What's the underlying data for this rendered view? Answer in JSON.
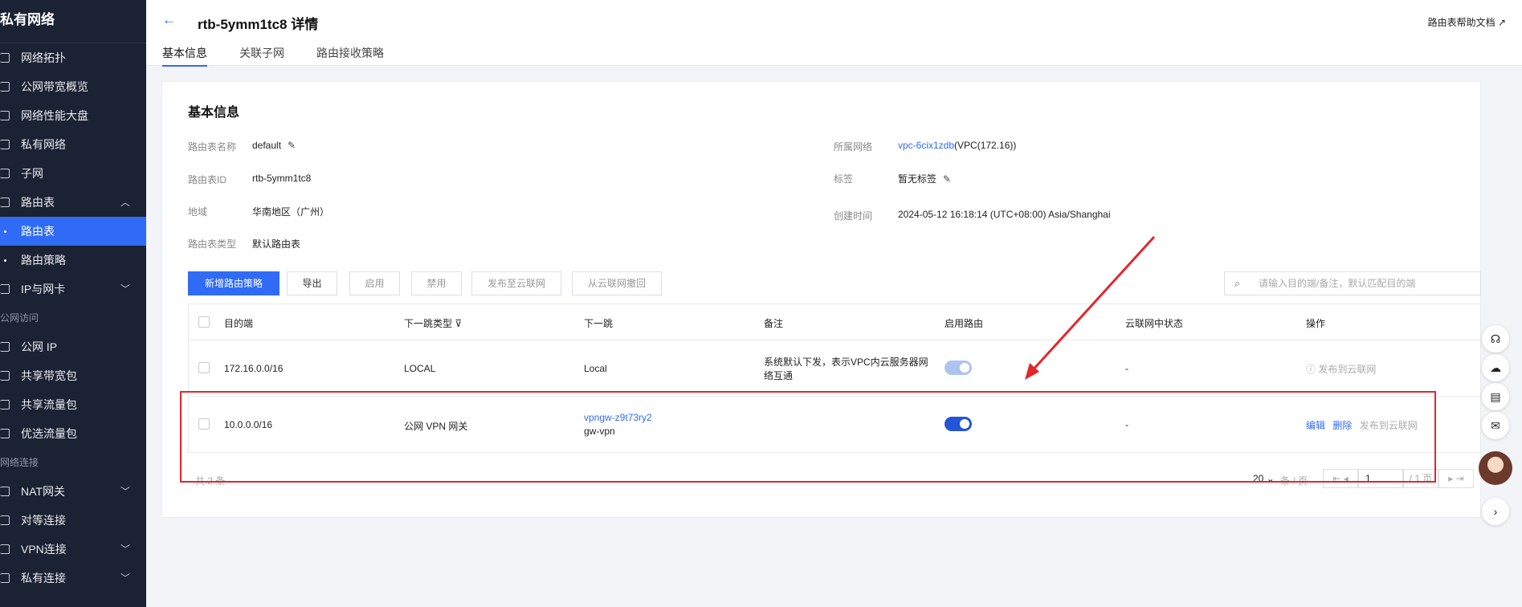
{
  "sidebar": {
    "title": "私有网络",
    "items": [
      {
        "label": "网络拓扑"
      },
      {
        "label": "公网带宽概览"
      },
      {
        "label": "网络性能大盘"
      },
      {
        "label": "私有网络"
      },
      {
        "label": "子网"
      },
      {
        "label": "路由表"
      },
      {
        "label": "路由表"
      },
      {
        "label": "路由策略"
      },
      {
        "label": "IP与网卡"
      },
      {
        "label": "公网访问"
      },
      {
        "label": "公网 IP"
      },
      {
        "label": "共享带宽包"
      },
      {
        "label": "共享流量包"
      },
      {
        "label": "优选流量包"
      },
      {
        "label": "网络连接"
      },
      {
        "label": "NAT网关"
      },
      {
        "label": "对等连接"
      },
      {
        "label": "VPN连接"
      },
      {
        "label": "私有连接"
      }
    ]
  },
  "header": {
    "back": "←",
    "title": "rtb-5ymm1tc8 详情",
    "help": "路由表帮助文档",
    "help_icon": "↗",
    "tabs": [
      "基本信息",
      "关联子网",
      "路由接收策略"
    ]
  },
  "info": {
    "section_title": "基本信息",
    "name_label": "路由表名称",
    "name_value": "default",
    "id_label": "路由表ID",
    "id_value": "rtb-5ymm1tc8",
    "region_label": "地域",
    "region_value": "华南地区（广州）",
    "type_label": "路由表类型",
    "type_value": "默认路由表",
    "vpc_label": "所属网络",
    "vpc_link": "vpc-6cix1zdb",
    "vpc_suffix": "(VPC(172.16))",
    "tag_label": "标签",
    "tag_value": "暂无标签",
    "created_label": "创建时间",
    "created_value": "2024-05-12 16:18:14 (UTC+08:00) Asia/Shanghai"
  },
  "toolbar": {
    "add": "新增路由策略",
    "export": "导出",
    "enable": "启用",
    "disable": "禁用",
    "publish": "发布至云联网",
    "withdraw": "从云联网撤回",
    "search_placeholder": "请输入目的端/备注，默认匹配目的端"
  },
  "table": {
    "headers": [
      "目的端",
      "下一跳类型",
      "下一跳",
      "备注",
      "启用路由",
      "云联网中状态",
      "操作"
    ],
    "rows": [
      {
        "dest": "172.16.0.0/16",
        "type": "LOCAL",
        "next": "Local",
        "next_sub": "",
        "remark_1": "系统默认下发，表示VPC内云服务器网",
        "remark_2": "络互通",
        "enabled": true,
        "ccn": "-",
        "op_publish": "发布到云联网"
      },
      {
        "dest": "10.0.0.0/16",
        "type": "公网 VPN 网关",
        "next": "vpngw-z9t73ry2",
        "next_sub": "gw-vpn",
        "remark_1": "",
        "remark_2": "",
        "enabled": true,
        "ccn": "-",
        "op_edit": "编辑",
        "op_delete": "删除",
        "op_publish": "发布到云联网"
      }
    ]
  },
  "footer": {
    "total": "共 2 条",
    "page_size": "20",
    "per_page": "条 / 页",
    "page": "1",
    "pages": "/ 1 页"
  },
  "colors": {
    "accent": "#2f6bf5",
    "sidebar": "#1b2233",
    "annotation": "#e3262c"
  }
}
